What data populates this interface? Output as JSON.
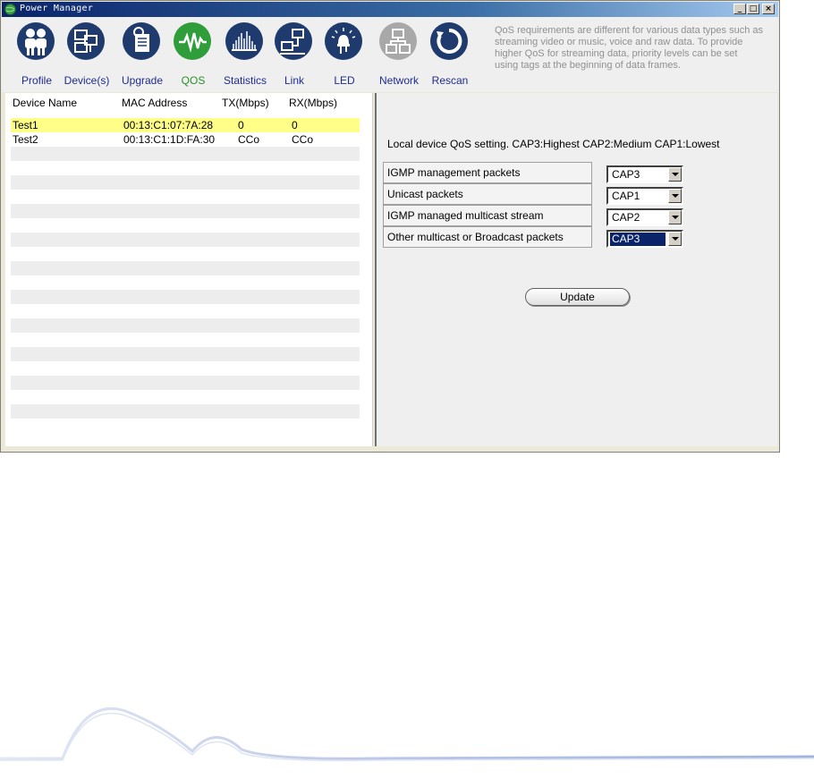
{
  "window": {
    "title": "Power Manager"
  },
  "toolbar": {
    "tools": [
      {
        "label": "Profile",
        "icon": "profile-icon",
        "color": "#1f3a6d"
      },
      {
        "label": "Device(s)",
        "icon": "devices-icon",
        "color": "#1f3a6d"
      },
      {
        "label": "Upgrade",
        "icon": "upgrade-icon",
        "color": "#1f3a6d"
      },
      {
        "label": "QOS",
        "icon": "qos-wave-icon",
        "color": "#2f9e3a",
        "active": true
      },
      {
        "label": "Statistics",
        "icon": "statistics-icon",
        "color": "#1f3a6d"
      },
      {
        "label": "Link",
        "icon": "link-icon",
        "color": "#1f3a6d"
      },
      {
        "label": "LED",
        "icon": "led-icon",
        "color": "#1f3a6d"
      },
      {
        "label": "Network",
        "icon": "network-icon",
        "color": "#a8a8a8"
      },
      {
        "label": "Rescan",
        "icon": "rescan-icon",
        "color": "#1f3a6d"
      }
    ],
    "description": "QoS requirements are different for various data types such as streaming video or music, voice and raw data. To provide higher QoS for streaming data, priority levels can be set using tags at the beginning of data frames."
  },
  "devices": {
    "columns": [
      "Device Name",
      "MAC Address",
      "TX(Mbps)",
      "RX(Mbps)"
    ],
    "rows": [
      {
        "name": "Test1",
        "mac": "00:13:C1:07:7A:28",
        "tx": "0",
        "rx": "0",
        "selected": true
      },
      {
        "name": "Test2",
        "mac": "00:13:C1:1D:FA:30",
        "tx": "CCo",
        "rx": "CCo",
        "selected": false
      }
    ]
  },
  "qos": {
    "heading": "Local device QoS setting. CAP3:Highest CAP2:Medium CAP1:Lowest",
    "settings": [
      {
        "label": "IGMP management packets",
        "value": "CAP3"
      },
      {
        "label": "Unicast packets",
        "value": "CAP1"
      },
      {
        "label": "IGMP managed multicast stream",
        "value": "CAP2"
      },
      {
        "label": "Other multicast or Broadcast packets",
        "value": "CAP3",
        "focused": true
      }
    ],
    "update_label": "Update"
  }
}
